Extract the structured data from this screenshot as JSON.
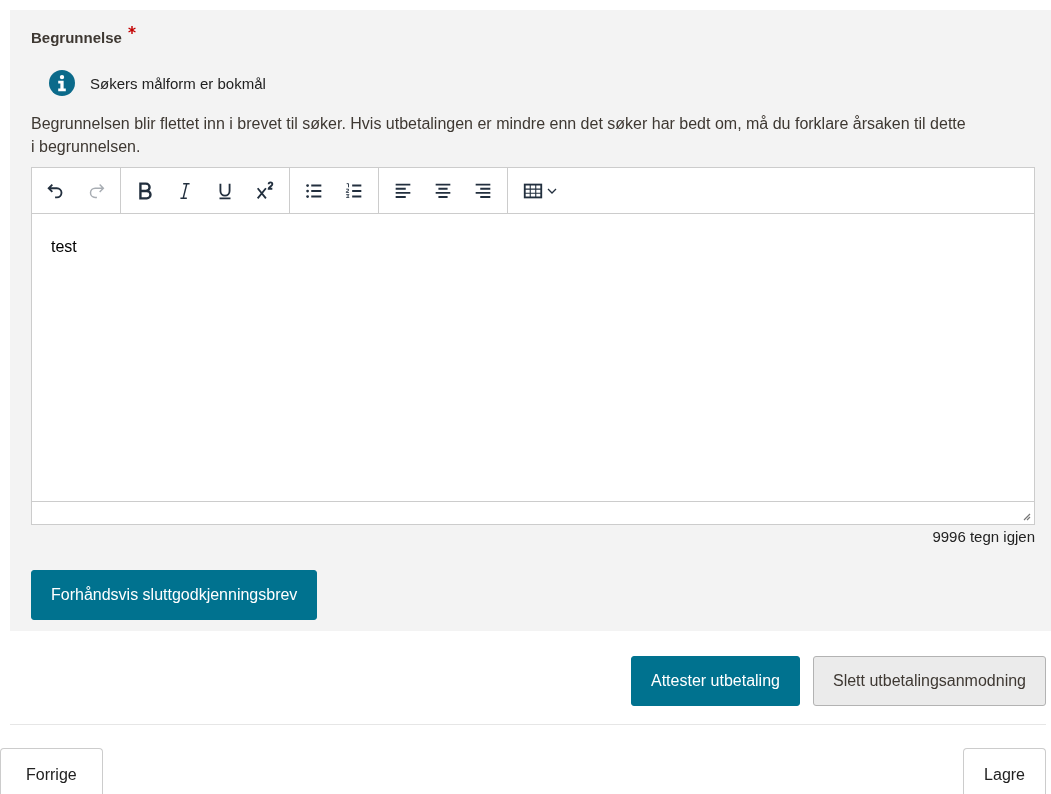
{
  "field": {
    "label": "Begrunnelse",
    "required": true,
    "info": "Søkers målform er bokmål",
    "description": "Begrunnelsen blir flettet inn i brevet til søker. Hvis utbetalingen er mindre enn det søker har bedt om, må du forklare årsaken til dette i begrunnelsen."
  },
  "editor": {
    "toolbar": [
      [
        {
          "kind": "undo",
          "disabled": false
        },
        {
          "kind": "redo",
          "disabled": true
        }
      ],
      [
        {
          "kind": "bold",
          "disabled": false
        },
        {
          "kind": "italic",
          "disabled": false
        },
        {
          "kind": "underline",
          "disabled": false
        },
        {
          "kind": "superscript",
          "disabled": false
        }
      ],
      [
        {
          "kind": "bullets",
          "disabled": false
        },
        {
          "kind": "numbers",
          "disabled": false
        }
      ],
      [
        {
          "kind": "align-left",
          "disabled": false
        },
        {
          "kind": "align-center",
          "disabled": false
        },
        {
          "kind": "align-right",
          "disabled": false
        }
      ],
      [
        {
          "kind": "table",
          "disabled": false
        }
      ]
    ],
    "value": "test",
    "counter": "9996 tegn igjen"
  },
  "preview_button": "Forhåndsvis sluttgodkjenningsbrev",
  "actions": [
    {
      "label": "Attester utbetaling",
      "kind": "primary"
    },
    {
      "label": "Slett utbetalingsanmodning",
      "kind": "secondary"
    }
  ],
  "footer": {
    "back": "Forrige",
    "save": "Lagre"
  }
}
